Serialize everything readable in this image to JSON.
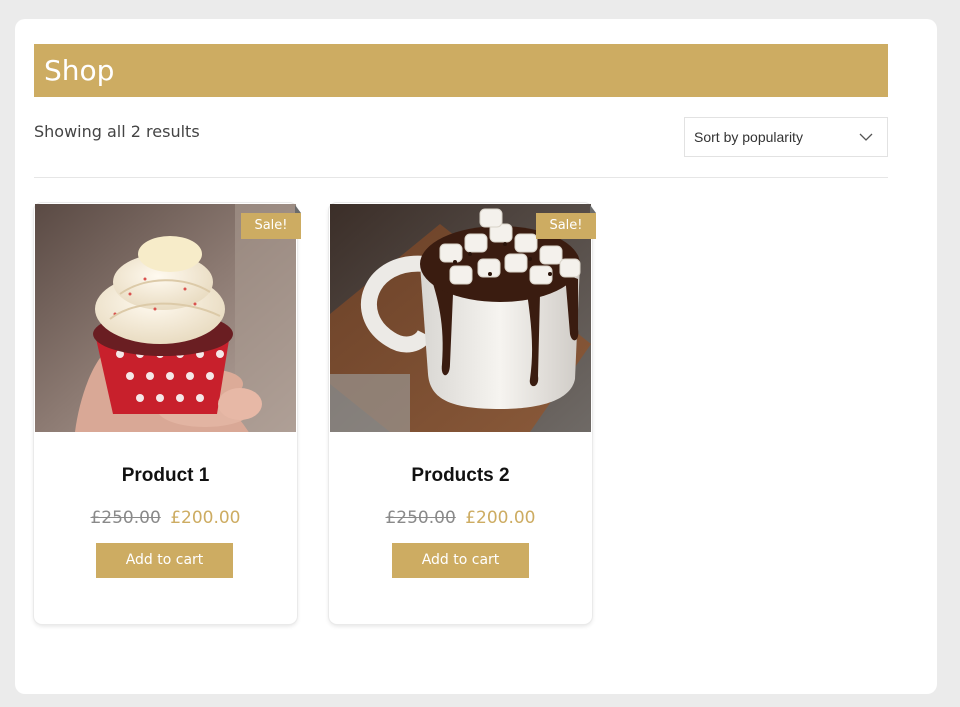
{
  "page": {
    "title": "Shop"
  },
  "toolbar": {
    "result_count": "Showing all 2 results",
    "sort": {
      "selected": "Sort by popularity"
    }
  },
  "products": [
    {
      "name": "Product 1",
      "badge": "Sale!",
      "regular_price": "£250.00",
      "sale_price": "£200.00",
      "button": "Add to cart",
      "image": "cupcake-photo"
    },
    {
      "name": "Products 2",
      "badge": "Sale!",
      "regular_price": "£250.00",
      "sale_price": "£200.00",
      "button": "Add to cart",
      "image": "hot-chocolate-photo"
    }
  ],
  "colors": {
    "accent": "#cdac62",
    "background": "#ebebeb",
    "panel": "#ffffff",
    "old_price": "#8a8a8a"
  }
}
